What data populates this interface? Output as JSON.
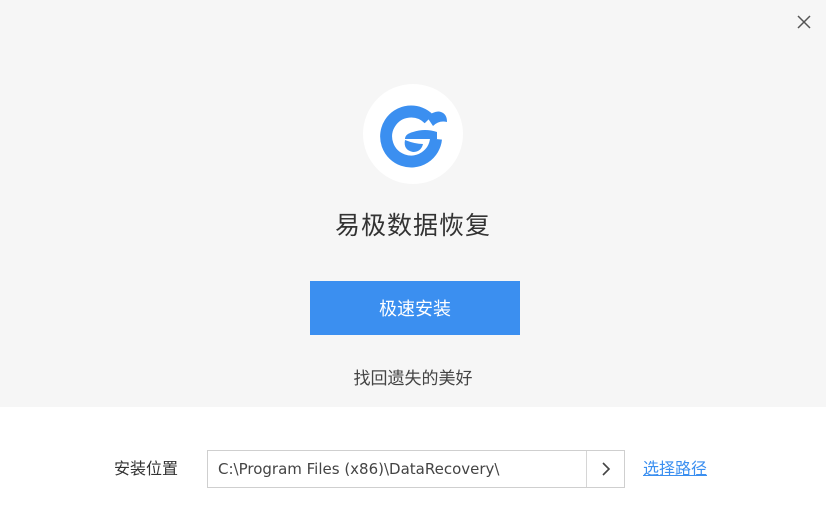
{
  "app": {
    "title": "易极数据恢复",
    "slogan": "找回遗失的美好"
  },
  "install_button": {
    "label": "极速安装"
  },
  "install_path": {
    "label": "安装位置",
    "value": "C:\\Program Files (x86)\\DataRecovery\\",
    "choose_label": "选择路径"
  },
  "colors": {
    "accent": "#3b8ff0",
    "top_background": "#f6f6f6",
    "bottom_background": "#ffffff"
  },
  "icons": {
    "close": "close-icon",
    "logo": "app-logo-icon",
    "arrow": "chevron-right-icon"
  }
}
